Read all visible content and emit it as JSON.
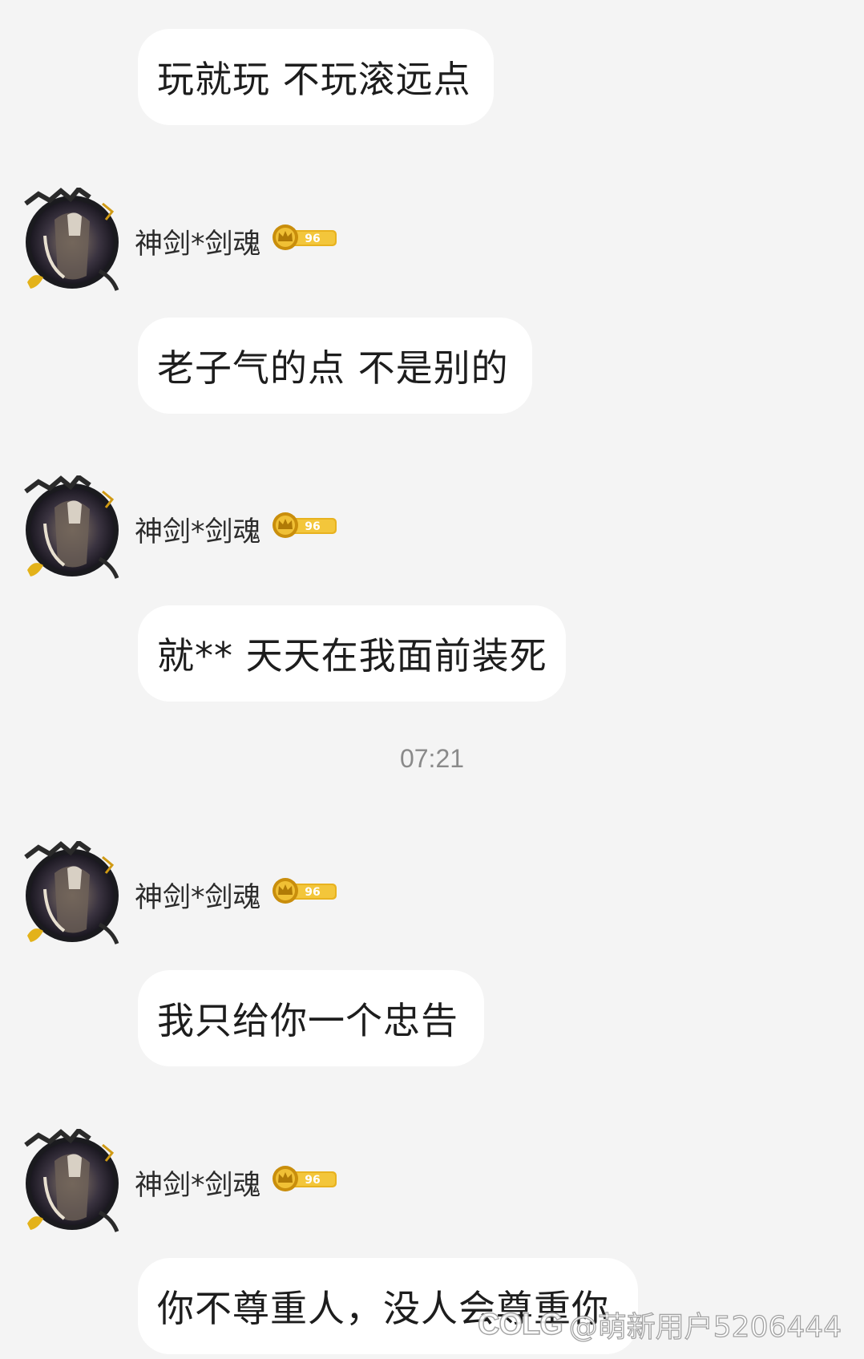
{
  "sender": {
    "name": "神剑*剑魂",
    "level": "96"
  },
  "messages": [
    {
      "text": "玩就玩 不玩滚远点"
    },
    {
      "text": "老子气的点 不是别的"
    },
    {
      "text": "就** 天天在我面前装死"
    },
    {
      "text": "我只给你一个忠告"
    },
    {
      "text": "你不尊重人，没人会尊重你"
    }
  ],
  "timestamp": "07:21",
  "watermark": {
    "logo": "COLG",
    "text": "@萌新用户5206444"
  },
  "colors": {
    "background": "#f4f4f4",
    "bubble": "#ffffff",
    "badge_gold": "#e8b21f"
  },
  "icons": {
    "avatar": "avatar-image",
    "level_badge": "crown-level-badge-icon"
  }
}
